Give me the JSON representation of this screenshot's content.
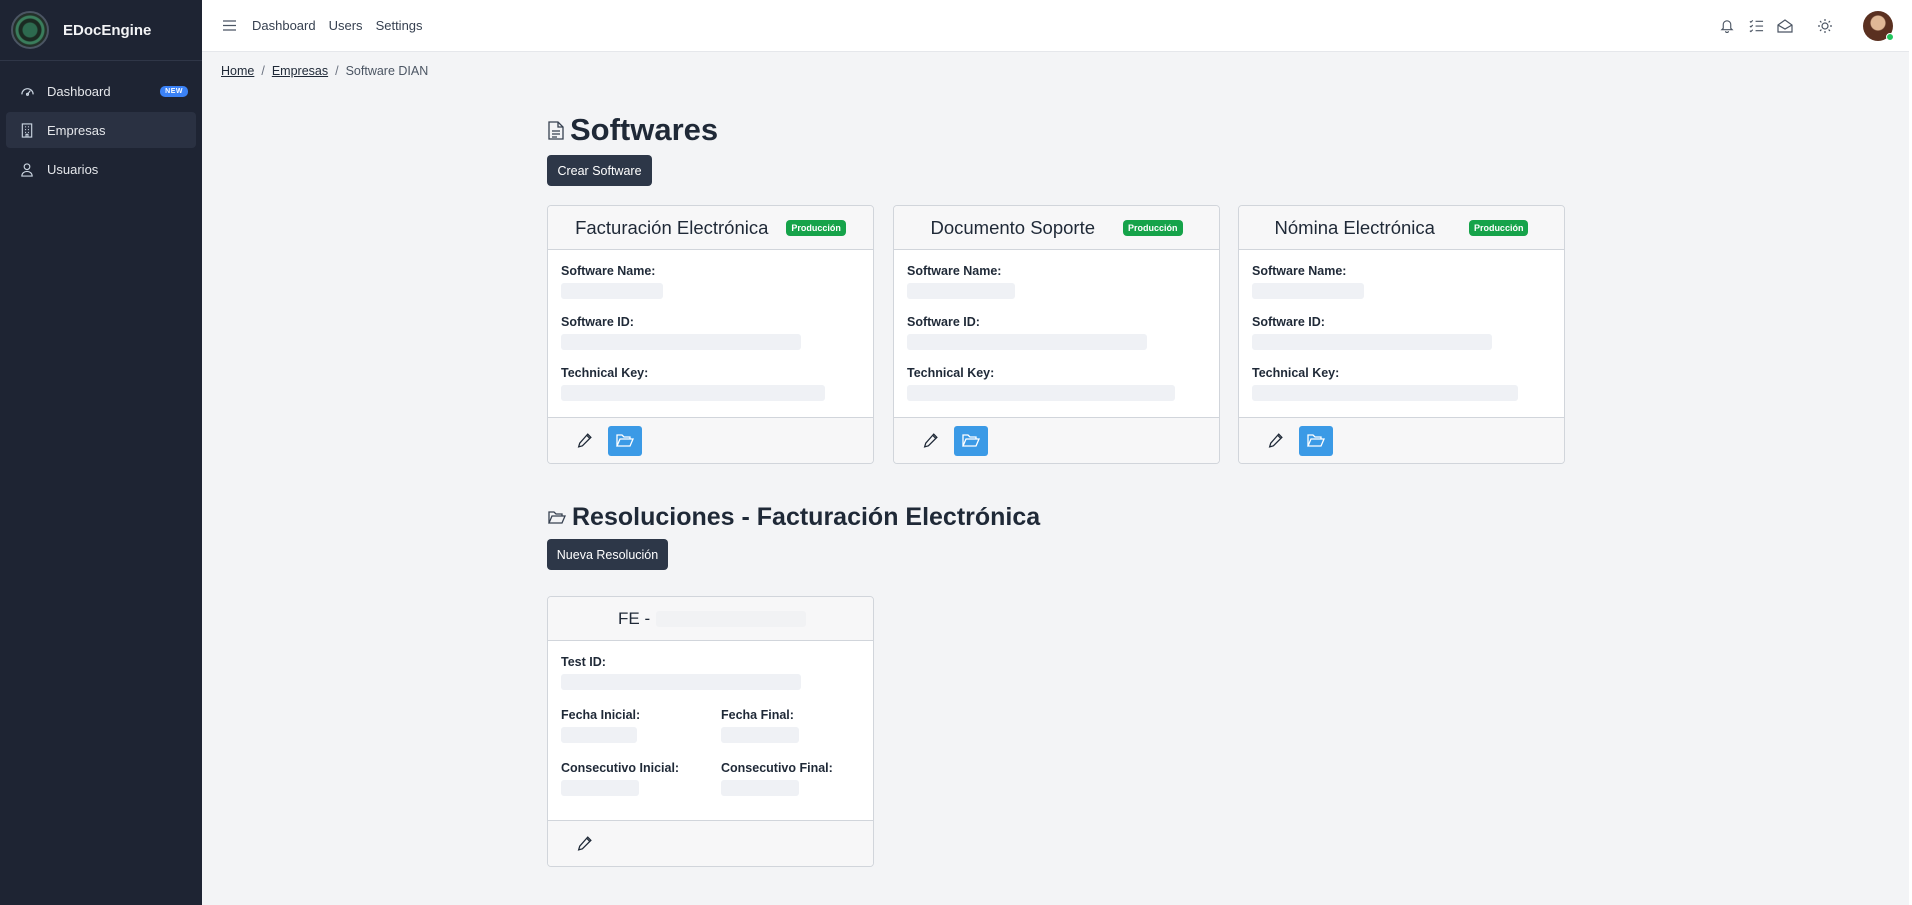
{
  "app": {
    "name": "EDocEngine"
  },
  "sidebar": {
    "items": [
      {
        "label": "Dashboard",
        "badge": "NEW",
        "icon": "gauge-icon"
      },
      {
        "label": "Empresas",
        "icon": "building-icon"
      },
      {
        "label": "Usuarios",
        "icon": "user-icon"
      }
    ]
  },
  "header": {
    "links": [
      "Dashboard",
      "Users",
      "Settings"
    ],
    "icons": [
      "bell-icon",
      "list-check-icon",
      "envelope-open-icon",
      "sun-icon"
    ]
  },
  "breadcrumb": {
    "home": "Home",
    "empresas": "Empresas",
    "current": "Software DIAN"
  },
  "softwares": {
    "title": "Softwares",
    "create_button": "Crear Software",
    "cards": [
      {
        "title": "Facturación Electrónica",
        "badge": "Producción"
      },
      {
        "title": "Documento Soporte",
        "badge": "Producción"
      },
      {
        "title": "Nómina Electrónica",
        "badge": "Producción"
      }
    ],
    "labels": {
      "name": "Software Name:",
      "id": "Software ID:",
      "key": "Technical Key:"
    }
  },
  "resoluciones": {
    "title": "Resoluciones - Facturación Electrónica",
    "new_button": "Nueva Resolución",
    "card": {
      "title": "FE -",
      "test_id": "Test ID:",
      "fecha_inicial": "Fecha Inicial:",
      "fecha_final": "Fecha Final:",
      "consecutivo_inicial": "Consecutivo Inicial:",
      "consecutivo_final": "Consecutivo Final:"
    }
  },
  "colors": {
    "sidebar": "#1e2433",
    "accent": "#3b9ae6",
    "success": "#16a34a",
    "dark_button": "#2d3748"
  }
}
